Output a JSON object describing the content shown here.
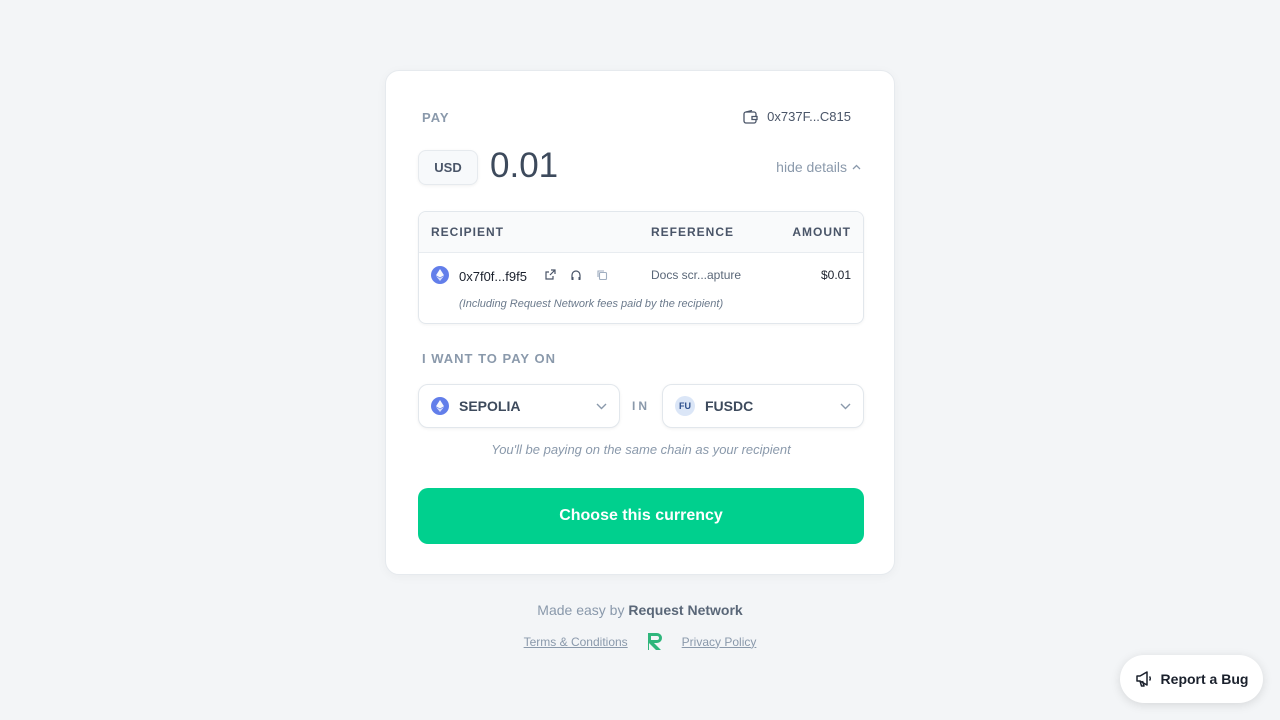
{
  "header": {
    "pay_label": "PAY",
    "wallet_address": "0x737F...C815",
    "currency": "USD",
    "amount": "0.01",
    "hide_details_label": "hide details"
  },
  "details": {
    "columns": [
      "RECIPIENT",
      "REFERENCE",
      "AMOUNT"
    ],
    "row": {
      "address": "0x7f0f...f9f5",
      "reference": "Docs scr...apture",
      "amount": "$0.01",
      "fees_note": "(Including Request Network fees paid by the recipient)"
    }
  },
  "payment": {
    "want_label": "I WANT TO PAY ON",
    "network": "SEPOLIA",
    "in_label": "IN",
    "token_icon_text": "FU",
    "token": "FUSDC",
    "same_chain_note": "You'll be paying on the same chain as your recipient",
    "choose_button": "Choose this currency"
  },
  "footer": {
    "made_easy_prefix": "Made easy by",
    "made_easy_brand": "Request Network",
    "terms_link": "Terms & Conditions",
    "privacy_link": "Privacy Policy"
  },
  "report_bug": "Report a Bug",
  "colors": {
    "accent": "#00d08e",
    "eth": "#627eea",
    "brand_logo": "#2fb67c"
  }
}
